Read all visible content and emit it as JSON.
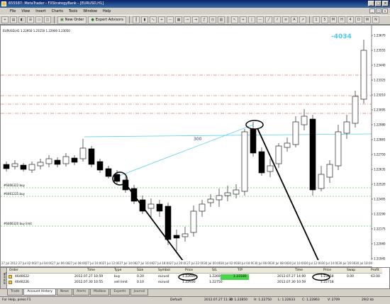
{
  "window": {
    "title": "655587: MetaTrader - FXStrategyBank - [EURUSD,H1]"
  },
  "menu": [
    "File",
    "View",
    "Insert",
    "Charts",
    "Tools",
    "Window",
    "Help"
  ],
  "toolbar": {
    "new_order": "New Order",
    "expert_advisors": "Expert Advisors"
  },
  "chart": {
    "symbol_info": "EURUSD,H1  1.22950 1.23150 1.22900 1.23050",
    "annotation_top": "-4034",
    "annotation_mid": "300",
    "line_labels": [
      "#6466322 buy",
      "#6461225 buy",
      "#6466320 buy limit"
    ],
    "price_labels": [
      "1.23670",
      "1.23555",
      "1.23440",
      "1.23325",
      "1.23210",
      "1.23095",
      "1.22980",
      "1.22865",
      "1.22750",
      "1.22635",
      "1.22520",
      "1.22405",
      "1.22290",
      "1.22175",
      "1.22060",
      "1.21945"
    ],
    "time_labels": [
      "27 Jul 2012",
      "27 Jul 02:00",
      "27 Jul 04:00",
      "27 Jul 06:00",
      "27 Jul 08:00",
      "27 Jul 10:00",
      "27 Jul 12:00",
      "27 Jul 14:00",
      "27 Jul 16:00",
      "27 Jul 18:00",
      "27 Jul 20:00",
      "27 Jul 22:00",
      "30 Jul 00:00",
      "30 Jul 02:00",
      "30 Jul 04:00",
      "30 Jul 06:00",
      "30 Jul 08:00",
      "30 Jul 10:00",
      "30 Jul 12:00",
      "30 Jul 14:00",
      "30 Jul 16:00",
      "30 Jul 18:00"
    ]
  },
  "terminal": {
    "side_label": "Terminal",
    "headers": [
      "Order",
      "Time",
      "Type",
      "Size",
      "Symbol",
      "Price",
      "S/L",
      "T/P",
      "Time",
      "Price",
      "Swap",
      "Profit"
    ],
    "rows": [
      [
        "4646622",
        "2012.07.27 10:59",
        "buy",
        "0.20",
        "eurusd",
        "1.22690",
        "1.22690",
        "1.23180",
        "2012.07.27 14:00",
        "1.23058",
        "0.00",
        "63.00"
      ],
      [
        "4646226",
        "2012.07.30 10:55",
        "sell limit",
        "0.10",
        "eurusd",
        "1.22930",
        "1.22750",
        "",
        "2012.07.30 10:59",
        "1.22718",
        "",
        ""
      ]
    ]
  },
  "tabs": [
    "Trade",
    "Account History",
    "News",
    "Alerts",
    "Mailbox",
    "Experts",
    "Journal"
  ],
  "status": {
    "help": "For Help, press F1",
    "profile": "Default",
    "datetime": "2012.07.27 11:30",
    "open": "O: 1.22850",
    "high": "H: 1.22750",
    "low": "L: 1.22633",
    "close": "C: 1.22863",
    "volume": "V: 2709",
    "traffic": "29/2 kb"
  },
  "colors": {
    "bull": "#ffffff",
    "bear": "#000000",
    "trendline": "#5ad0f0",
    "sl_line": "#d04020",
    "entry_line": "#30b030"
  },
  "icons": [
    "new-order-icon",
    "expert-advisors-icon",
    "zoom-in-icon",
    "zoom-out-icon",
    "crosshair-icon",
    "line-tool-icon",
    "text-tool-icon",
    "arrow-tool-icon",
    "period-m1-icon",
    "period-h1-icon",
    "period-d1-icon"
  ]
}
